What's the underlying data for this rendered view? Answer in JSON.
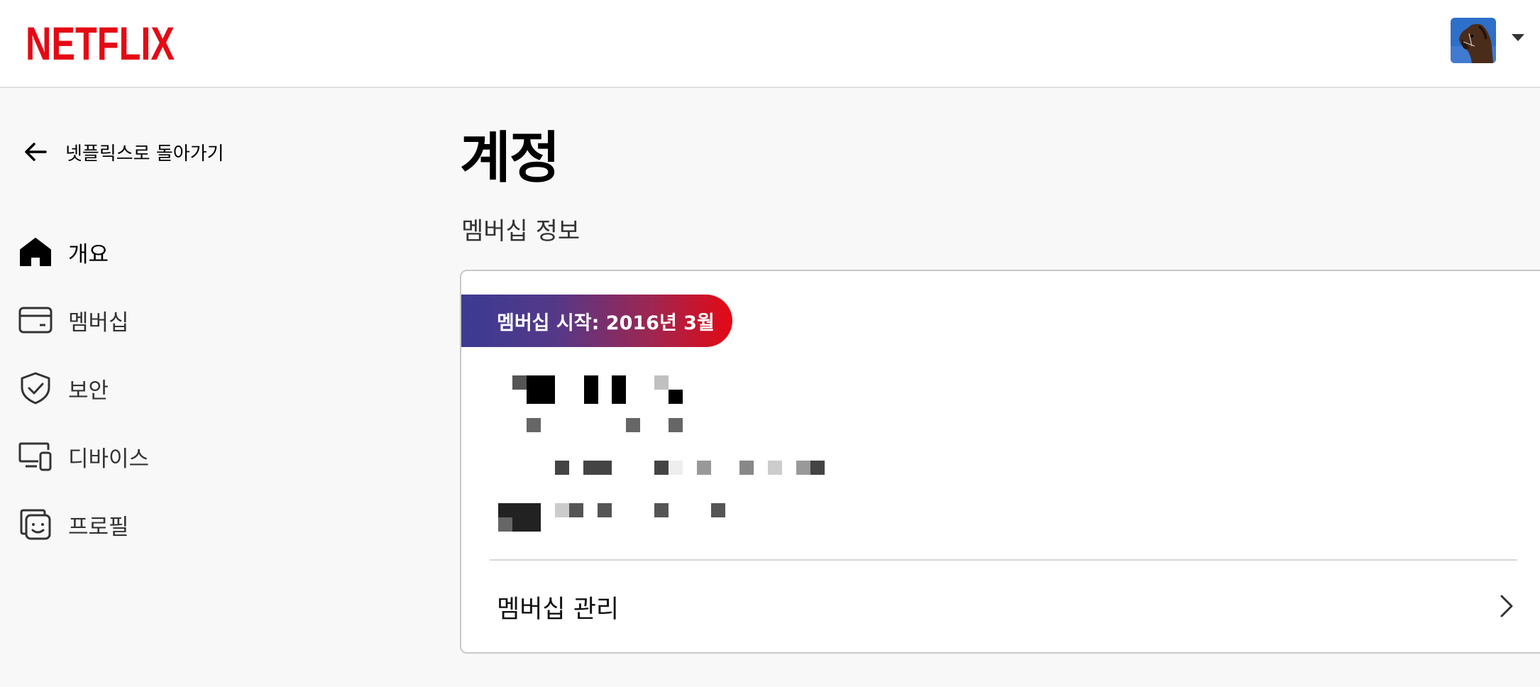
{
  "header": {
    "logo_text": "NETFLIX",
    "brand_color": "#e50914",
    "avatar_icon": "profile-avatar-horse",
    "menu_icon": "caret-down-icon"
  },
  "back_link": {
    "label": "넷플릭스로 돌아가기",
    "icon": "arrow-left-icon"
  },
  "nav": {
    "items": [
      {
        "label": "개요",
        "icon": "home-icon",
        "active": true
      },
      {
        "label": "멤버십",
        "icon": "credit-card-icon",
        "active": false
      },
      {
        "label": "보안",
        "icon": "shield-check-icon",
        "active": false
      },
      {
        "label": "디바이스",
        "icon": "devices-icon",
        "active": false
      },
      {
        "label": "프로필",
        "icon": "profiles-icon",
        "active": false
      }
    ]
  },
  "main": {
    "title": "계정",
    "section_label": "멤버십 정보",
    "card": {
      "member_since": "멤버십 시작: 2016년 3월",
      "plan_info": "[redacted - pixelated]",
      "manage_label": "멤버십 관리",
      "manage_icon": "chevron-right-icon"
    }
  }
}
